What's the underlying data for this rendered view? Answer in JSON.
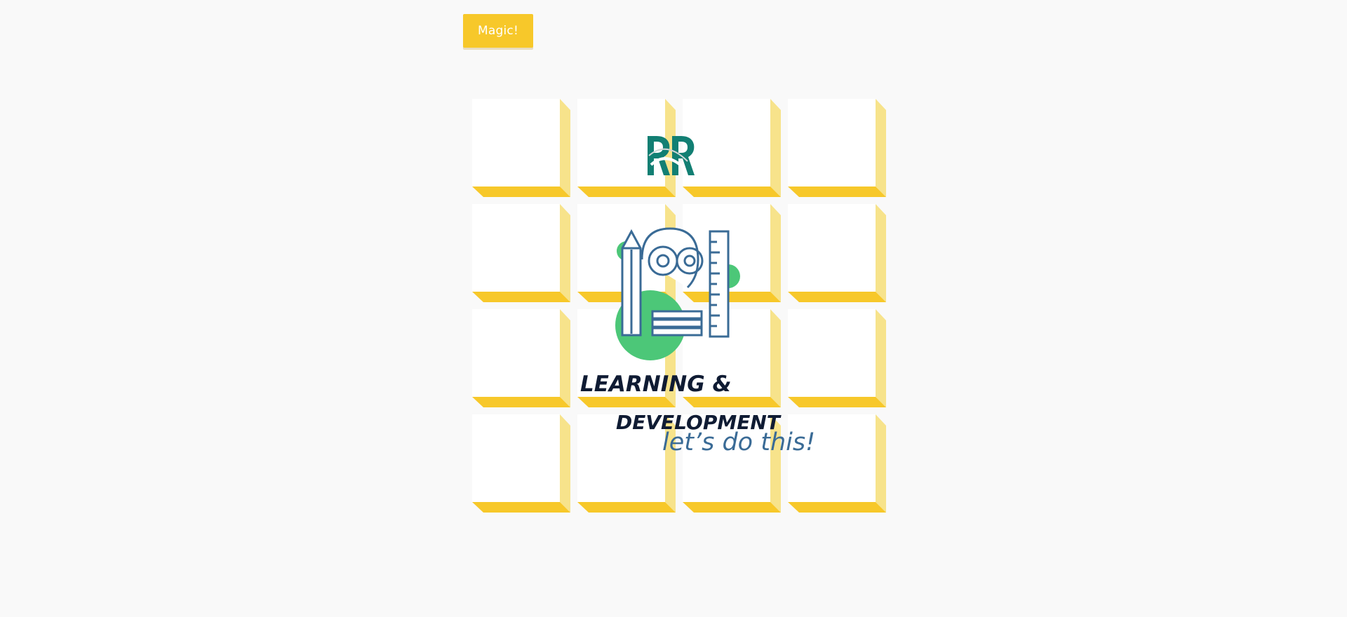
{
  "toolbar": {
    "magic_label": "Magic!"
  },
  "colors": {
    "background": "#f9f9f9",
    "accent": "#f7c82a",
    "tile_face": "#ffffff",
    "tile_side": "#f7e38b",
    "tile_bottom": "#f7c82a",
    "logo_teal": "#127f73",
    "artwork_blue": "#3a6b96",
    "artwork_green": "#4cc778",
    "artwork_navy": "#0f1b33"
  },
  "grid": {
    "rows": 4,
    "columns": 4
  },
  "artwork": {
    "headline_line1": "LEARNING &",
    "headline_line2": "DEVELOPMENT",
    "tagline": "let’s do this!",
    "icons": [
      "rr-logo-icon",
      "pencil-icon",
      "gear-icon",
      "ruler-icon",
      "book-icon"
    ]
  }
}
